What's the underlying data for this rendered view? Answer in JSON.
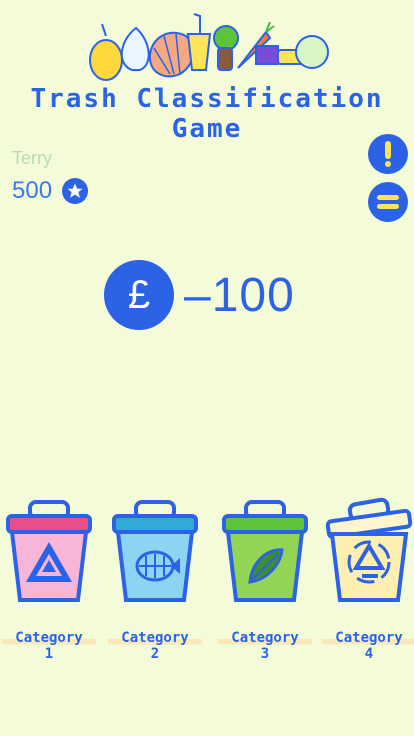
{
  "app": {
    "title_line1": "Trash Classification",
    "title_line2": "Game"
  },
  "player": {
    "name": "Terry",
    "score": "500",
    "score_icon": "star-icon"
  },
  "controls": {
    "alert_icon": "exclamation-icon",
    "menu_icon": "equals-icon"
  },
  "coin": {
    "symbol": "£",
    "delta": "–100"
  },
  "bins": [
    {
      "label": "Category",
      "number": "1",
      "lid_color": "#e84f8a",
      "body_color": "#f7b5d8",
      "icon": "hazard-icon"
    },
    {
      "label": "Category",
      "number": "2",
      "lid_color": "#33a9d8",
      "body_color": "#8dd3f2",
      "icon": "fish-bones-icon"
    },
    {
      "label": "Category",
      "number": "3",
      "lid_color": "#5cc43a",
      "body_color": "#92d454",
      "icon": "leaf-icon"
    },
    {
      "label": "Category",
      "number": "4",
      "lid_color": "#fff6ce",
      "body_color": "#fcefb0",
      "icon": "recycle-icon"
    }
  ],
  "colors": {
    "accent": "#2b62e6",
    "background": "#f3fbd9"
  }
}
